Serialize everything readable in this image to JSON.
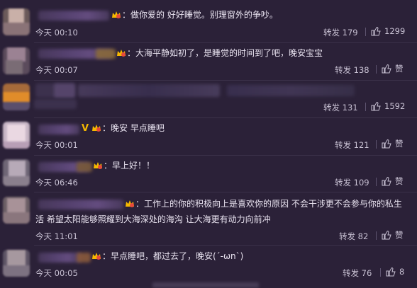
{
  "labels": {
    "repost": "转发",
    "like_icon": "thumbs-up-icon"
  },
  "colors": {
    "background": "#2b2138",
    "text": "#eae4f1",
    "meta": "#c9c2d4",
    "badge_gold": "#f5b800"
  },
  "comments": [
    {
      "text": "：做你爱的  好好睡觉。别理窗外的争吵。",
      "time": "今天 00:10",
      "repost_count": "179",
      "like_label": "1299"
    },
    {
      "text": "：大海平静如初了，是睡觉的时间到了吧，晚安宝宝",
      "time": "今天 00:07",
      "repost_count": "138",
      "like_label": "赞"
    },
    {
      "text": "",
      "time": "",
      "repost_count": "131",
      "like_label": "1592"
    },
    {
      "verified_mark": "V",
      "text": "：晚安 早点睡吧",
      "time": "今天 00:01",
      "repost_count": "121",
      "like_label": "赞"
    },
    {
      "text": "：早上好！！",
      "time": "今天 06:46",
      "repost_count": "109",
      "like_label": "赞"
    },
    {
      "text": "：工作上的你的积极向上是喜欢你的原因 不会干涉更不会参与你的私生",
      "text_cont": "活 希望太阳能够照耀到大海深处的海沟 让大海更有动力向前冲",
      "time": "今天 11:01",
      "repost_count": "82",
      "like_label": "赞"
    },
    {
      "text": "：早点睡吧，都过去了，晚安(´-ωn`)",
      "time": "今天 00:05",
      "repost_count": "76",
      "like_label": "8"
    }
  ]
}
